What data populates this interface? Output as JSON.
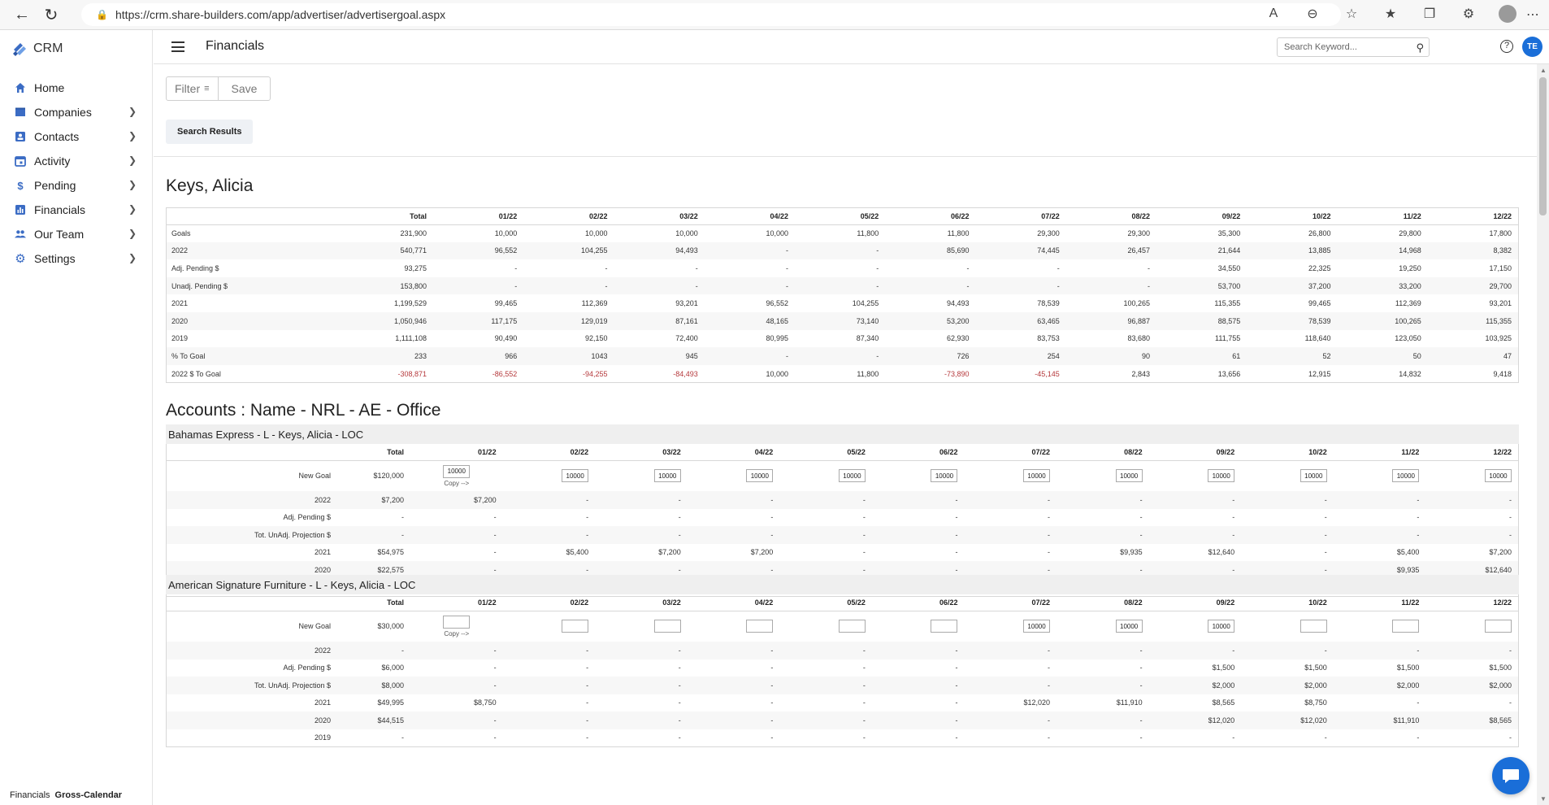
{
  "browser": {
    "url": "https://crm.share-builders.com/app/advertiser/advertisergoal.aspx"
  },
  "brand": {
    "name": "CRM",
    "color": "#3b6cc4"
  },
  "sidebar": {
    "items": [
      {
        "label": "Home",
        "icon": "home-icon",
        "has_children": false
      },
      {
        "label": "Companies",
        "icon": "building-icon",
        "has_children": true
      },
      {
        "label": "Contacts",
        "icon": "contact-card-icon",
        "has_children": true
      },
      {
        "label": "Activity",
        "icon": "calendar-icon",
        "has_children": true
      },
      {
        "label": "Pending",
        "icon": "dollar-icon",
        "has_children": true
      },
      {
        "label": "Financials",
        "icon": "bar-chart-icon",
        "has_children": true
      },
      {
        "label": "Our Team",
        "icon": "people-icon",
        "has_children": true
      },
      {
        "label": "Settings",
        "icon": "gear-icon",
        "has_children": true
      }
    ],
    "footer": {
      "module": "Financials",
      "view": "Gross-Calendar"
    }
  },
  "appbar": {
    "title": "Financials",
    "search_placeholder": "Search Keyword...",
    "avatar_initials": "TE"
  },
  "toolbar": {
    "filter_label": "Filter",
    "save_label": "Save",
    "search_results_label": "Search Results"
  },
  "summary": {
    "title": "Keys, Alicia",
    "columns": [
      "",
      "Total",
      "01/22",
      "02/22",
      "03/22",
      "04/22",
      "05/22",
      "06/22",
      "07/22",
      "08/22",
      "09/22",
      "10/22",
      "11/22",
      "12/22"
    ],
    "rows": [
      {
        "label": "Goals",
        "values": [
          "231,900",
          "10,000",
          "10,000",
          "10,000",
          "10,000",
          "11,800",
          "11,800",
          "29,300",
          "29,300",
          "35,300",
          "26,800",
          "29,800",
          "17,800"
        ]
      },
      {
        "label": "2022",
        "values": [
          "540,771",
          "96,552",
          "104,255",
          "94,493",
          "-",
          "-",
          "85,690",
          "74,445",
          "26,457",
          "21,644",
          "13,885",
          "14,968",
          "8,382"
        ]
      },
      {
        "label": "Adj. Pending $",
        "values": [
          "93,275",
          "-",
          "-",
          "-",
          "-",
          "-",
          "-",
          "-",
          "-",
          "34,550",
          "22,325",
          "19,250",
          "17,150"
        ]
      },
      {
        "label": "Unadj. Pending $",
        "values": [
          "153,800",
          "-",
          "-",
          "-",
          "-",
          "-",
          "-",
          "-",
          "-",
          "53,700",
          "37,200",
          "33,200",
          "29,700"
        ]
      },
      {
        "label": "2021",
        "values": [
          "1,199,529",
          "99,465",
          "112,369",
          "93,201",
          "96,552",
          "104,255",
          "94,493",
          "78,539",
          "100,265",
          "115,355",
          "99,465",
          "112,369",
          "93,201"
        ]
      },
      {
        "label": "2020",
        "values": [
          "1,050,946",
          "117,175",
          "129,019",
          "87,161",
          "48,165",
          "73,140",
          "53,200",
          "63,465",
          "96,887",
          "88,575",
          "78,539",
          "100,265",
          "115,355"
        ]
      },
      {
        "label": "2019",
        "values": [
          "1,111,108",
          "90,490",
          "92,150",
          "72,400",
          "80,995",
          "87,340",
          "62,930",
          "83,753",
          "83,680",
          "111,755",
          "118,640",
          "123,050",
          "103,925"
        ]
      },
      {
        "label": "% To Goal",
        "values": [
          "233",
          "966",
          "1043",
          "945",
          "-",
          "-",
          "726",
          "254",
          "90",
          "61",
          "52",
          "50",
          "47"
        ]
      },
      {
        "label": "2022 $ To Goal",
        "values": [
          "-308,871",
          "-86,552",
          "-94,255",
          "-84,493",
          "10,000",
          "11,800",
          "-73,890",
          "-45,145",
          "2,843",
          "13,656",
          "12,915",
          "14,832",
          "9,418"
        ]
      }
    ]
  },
  "accounts": {
    "title": "Accounts : Name - NRL - AE - Office",
    "columns": [
      "",
      "Total",
      "01/22",
      "02/22",
      "03/22",
      "04/22",
      "05/22",
      "06/22",
      "07/22",
      "08/22",
      "09/22",
      "10/22",
      "11/22",
      "12/22"
    ],
    "copy_label": "Copy -->",
    "list": [
      {
        "header": "Bahamas Express  -  L  -  Keys, Alicia  -  LOC",
        "goal_label": "New Goal",
        "goal_total": "$120,000",
        "goal_inputs": [
          "10000",
          "10000",
          "10000",
          "10000",
          "10000",
          "10000",
          "10000",
          "10000",
          "10000",
          "10000",
          "10000",
          "10000"
        ],
        "rows": [
          {
            "label": "2022",
            "values": [
              "$7,200",
              "$7,200",
              "-",
              "-",
              "-",
              "-",
              "-",
              "-",
              "-",
              "-",
              "-",
              "-",
              "-"
            ]
          },
          {
            "label": "Adj. Pending $",
            "values": [
              "-",
              "-",
              "-",
              "-",
              "-",
              "-",
              "-",
              "-",
              "-",
              "-",
              "-",
              "-",
              "-"
            ]
          },
          {
            "label": "Tot. UnAdj. Projection $",
            "values": [
              "-",
              "-",
              "-",
              "-",
              "-",
              "-",
              "-",
              "-",
              "-",
              "-",
              "-",
              "-",
              "-"
            ]
          },
          {
            "label": "2021",
            "values": [
              "$54,975",
              "-",
              "$5,400",
              "$7,200",
              "$7,200",
              "-",
              "-",
              "-",
              "$9,935",
              "$12,640",
              "-",
              "$5,400",
              "$7,200"
            ]
          },
          {
            "label": "2020",
            "values": [
              "$22,575",
              "-",
              "-",
              "-",
              "-",
              "-",
              "-",
              "-",
              "-",
              "-",
              "-",
              "$9,935",
              "$12,640"
            ]
          },
          {
            "label": "2019",
            "values": [
              "-",
              "-",
              "-",
              "-",
              "-",
              "-",
              "-",
              "-",
              "-",
              "-",
              "-",
              "-",
              "-"
            ]
          }
        ]
      },
      {
        "header": "American Signature Furniture  -  L  -  Keys, Alicia  -  LOC",
        "goal_label": "New Goal",
        "goal_total": "$30,000",
        "goal_inputs": [
          "",
          "",
          "",
          "",
          "",
          "",
          "10000",
          "10000",
          "10000",
          "",
          "",
          ""
        ],
        "rows": [
          {
            "label": "2022",
            "values": [
              "-",
              "-",
              "-",
              "-",
              "-",
              "-",
              "-",
              "-",
              "-",
              "-",
              "-",
              "-",
              "-"
            ]
          },
          {
            "label": "Adj. Pending $",
            "values": [
              "$6,000",
              "-",
              "-",
              "-",
              "-",
              "-",
              "-",
              "-",
              "-",
              "$1,500",
              "$1,500",
              "$1,500",
              "$1,500"
            ]
          },
          {
            "label": "Tot. UnAdj. Projection $",
            "values": [
              "$8,000",
              "-",
              "-",
              "-",
              "-",
              "-",
              "-",
              "-",
              "-",
              "$2,000",
              "$2,000",
              "$2,000",
              "$2,000"
            ]
          },
          {
            "label": "2021",
            "values": [
              "$49,995",
              "$8,750",
              "-",
              "-",
              "-",
              "-",
              "-",
              "$12,020",
              "$11,910",
              "$8,565",
              "$8,750",
              "-",
              "-"
            ]
          },
          {
            "label": "2020",
            "values": [
              "$44,515",
              "-",
              "-",
              "-",
              "-",
              "-",
              "-",
              "-",
              "-",
              "$12,020",
              "$12,020",
              "$11,910",
              "$8,565"
            ]
          },
          {
            "label": "2019",
            "values": [
              "-",
              "-",
              "-",
              "-",
              "-",
              "-",
              "-",
              "-",
              "-",
              "-",
              "-",
              "-",
              "-"
            ]
          }
        ]
      }
    ]
  },
  "colors": {
    "negative": "#b5383b",
    "accent": "#1a6ed8",
    "row_alt": "#f7f7f7"
  }
}
